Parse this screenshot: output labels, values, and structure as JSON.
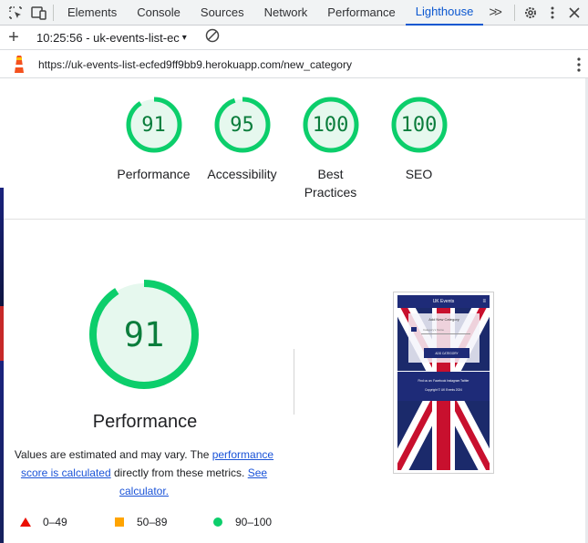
{
  "devtools": {
    "tabs": [
      "Elements",
      "Console",
      "Sources",
      "Network",
      "Performance",
      "Lighthouse"
    ],
    "active_tab": "Lighthouse",
    "more_tabs_label": ">>"
  },
  "report_bar": {
    "new_report_label": "+",
    "selected_report": "10:25:56 - uk-events-list-ec",
    "dropdown_caret": "▾"
  },
  "url_bar": {
    "url": "https://uk-events-list-ecfed9ff9bb9.herokuapp.com/new_category"
  },
  "gauges": [
    {
      "score": 91,
      "label": "Performance",
      "color": "#0cce6b"
    },
    {
      "score": 95,
      "label": "Accessibility",
      "color": "#0cce6b"
    },
    {
      "score": 100,
      "label": "Best Practices",
      "color": "#0cce6b"
    },
    {
      "score": 100,
      "label": "SEO",
      "color": "#0cce6b"
    }
  ],
  "performance": {
    "score": 91,
    "title": "Performance",
    "desc_part1": "Values are estimated and may vary. The ",
    "desc_link1": "performance score is calculated",
    "desc_part2": " directly from these metrics. ",
    "desc_link2": "See calculator."
  },
  "legend": [
    {
      "shape": "triangle",
      "color": "#eb0f00",
      "range": "0–49"
    },
    {
      "shape": "square",
      "color": "#ffa400",
      "range": "50–89"
    },
    {
      "shape": "circle",
      "color": "#0cce6b",
      "range": "90–100"
    }
  ],
  "screenshot_thumb": {
    "nav_title": "UK Events",
    "card_title": "Add New Category",
    "input_placeholder": "Category's Name",
    "button_label": "ADD CATEGORY",
    "footer_links": "Find us on:  Facebook  Instagram  Twitter",
    "copyright": "Copyright © UK Events 2024"
  },
  "colors": {
    "pass": "#0cce6b",
    "pass_text": "#0b7d3c",
    "pass_bg": "#e6f8ee",
    "accent": "#0b57d0",
    "link": "#1a53d8"
  }
}
